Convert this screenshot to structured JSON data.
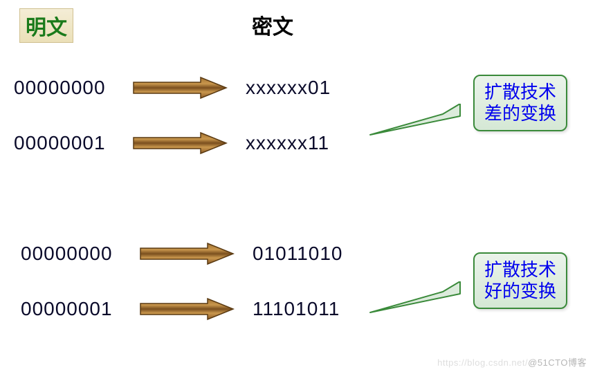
{
  "headers": {
    "plaintext": "明文",
    "ciphertext": "密文"
  },
  "rows": [
    {
      "plain": "00000000",
      "cipher": "xxxxxx01"
    },
    {
      "plain": "00000001",
      "cipher": "xxxxxx11"
    },
    {
      "plain": "00000000",
      "cipher": "01011010"
    },
    {
      "plain": "00000001",
      "cipher": "11101011"
    }
  ],
  "callouts": {
    "bad": {
      "line1": "扩散技术",
      "line2": "差的变换"
    },
    "good": {
      "line1": "扩散技术",
      "line2": "好的变换"
    }
  },
  "icons": {
    "arrow": "arrow-right"
  },
  "watermark": {
    "faint": "https://blog.csdn.net/",
    "main": "@51CTO博客"
  }
}
